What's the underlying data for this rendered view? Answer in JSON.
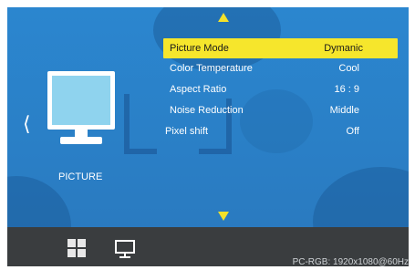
{
  "osd": {
    "section_label": "PICTURE",
    "menu_items": [
      {
        "label": "Picture Mode",
        "value": "Dymanic",
        "selected": true
      },
      {
        "label": "Color Temperature",
        "value": "Cool",
        "selected": false
      },
      {
        "label": "Aspect Ratio",
        "value": "16 : 9",
        "selected": false
      },
      {
        "label": "Noise Reduction",
        "value": "Middle",
        "selected": false
      },
      {
        "label": "Pixel shift",
        "value": "Off",
        "selected": false
      }
    ],
    "nav_left_glyph": "⟨",
    "source_info": "PC-RGB: 1920x1080@60Hz"
  },
  "colors": {
    "background": "#2a80c8",
    "highlight": "#f6e62c",
    "arrow": "#f4e12a",
    "bottom_bar": "#3a3d3f"
  },
  "icons": {
    "up": "up-arrow-icon",
    "down": "down-arrow-icon",
    "left": "chevron-left-icon",
    "monitor": "monitor-icon",
    "apps": "grid-icon",
    "pc": "pc-icon"
  }
}
